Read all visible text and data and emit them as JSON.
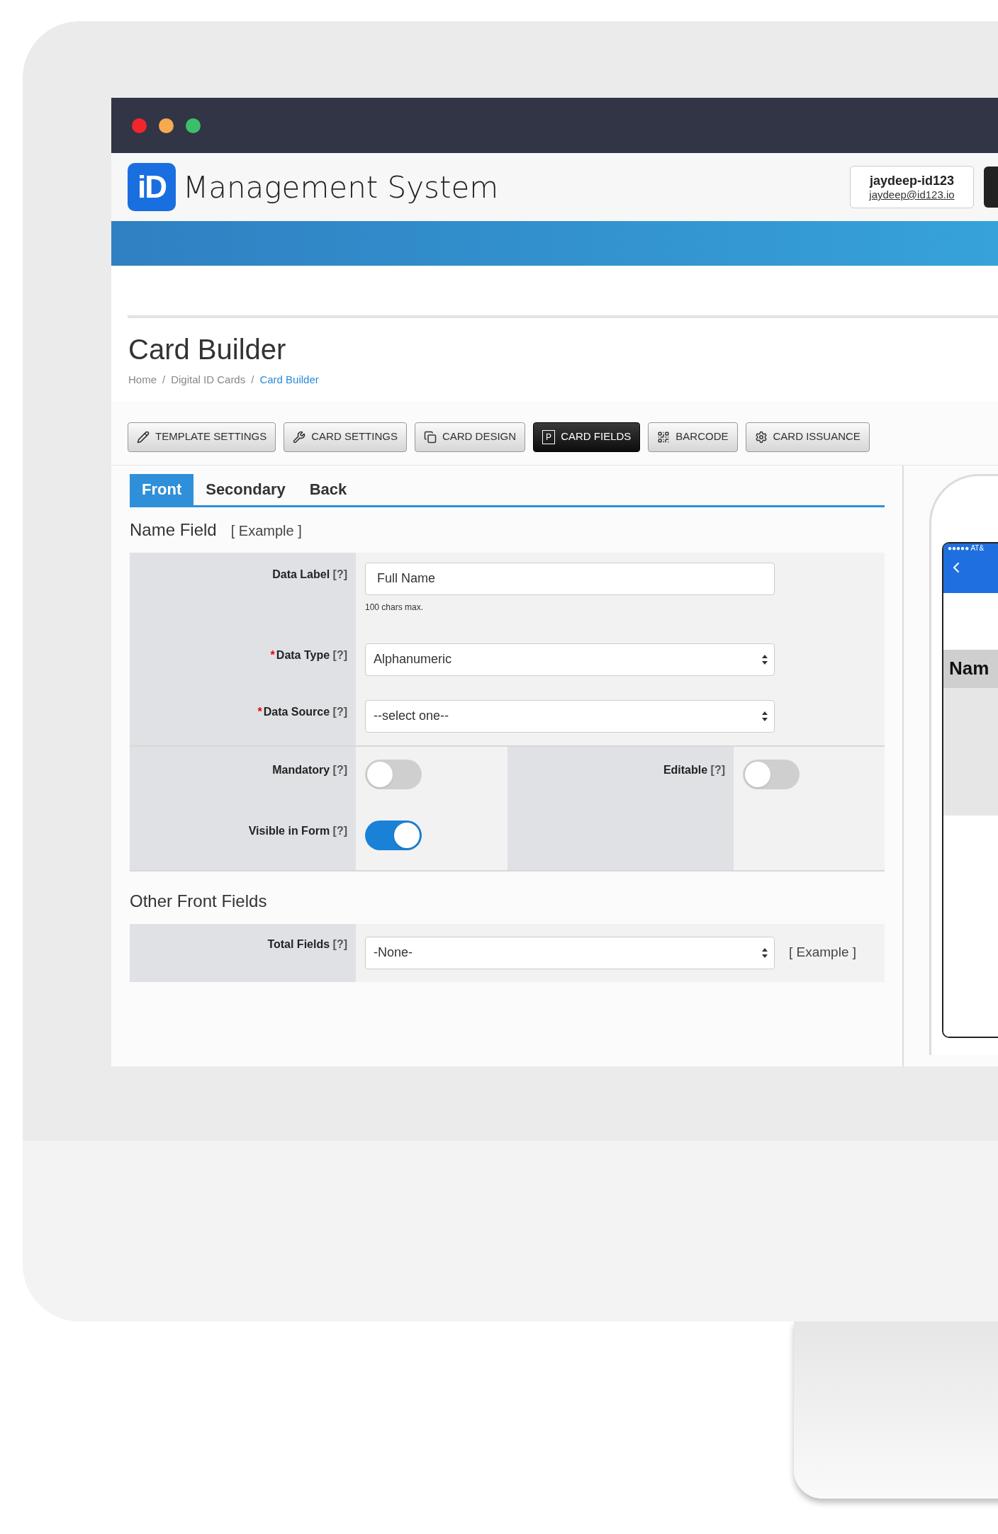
{
  "header": {
    "logo_text": "iD",
    "app_title": "Management System",
    "user": {
      "name": "jaydeep-id123",
      "email": "jaydeep@id123.io"
    }
  },
  "page": {
    "title": "Card Builder",
    "breadcrumb_separator": "/",
    "breadcrumb": [
      {
        "label": "Home",
        "current": false
      },
      {
        "label": "Digital ID Cards",
        "current": false
      },
      {
        "label": "Card Builder",
        "current": true
      }
    ]
  },
  "toolbar": [
    {
      "label": "TEMPLATE SETTINGS",
      "selected": false
    },
    {
      "label": "CARD SETTINGS",
      "selected": false
    },
    {
      "label": "CARD DESIGN",
      "selected": false
    },
    {
      "label": "CARD FIELDS",
      "selected": true,
      "icon_letter": "P"
    },
    {
      "label": "BARCODE",
      "selected": false
    },
    {
      "label": "CARD ISSUANCE",
      "selected": false
    }
  ],
  "tabs": [
    {
      "label": "Front",
      "selected": true
    },
    {
      "label": "Secondary",
      "selected": false
    },
    {
      "label": "Back",
      "selected": false
    }
  ],
  "name_field": {
    "title": "Name Field",
    "example": "[ Example ]",
    "fields": [
      {
        "kind": "text",
        "label": "Data Label",
        "help": "[?]",
        "value": "Full Name",
        "note": "100 chars max."
      },
      {
        "kind": "select",
        "required_mark": "*",
        "label": "Data Type",
        "help": "[?]",
        "value": "Alphanumeric"
      },
      {
        "kind": "select",
        "required_mark": "*",
        "label": "Data Source",
        "help": "[?]",
        "value": "--select one--"
      }
    ],
    "toggles_left": [
      {
        "label": "Mandatory",
        "help": "[?]",
        "on": false
      },
      {
        "label": "Visible in Form",
        "help": "[?]",
        "on": true
      }
    ],
    "toggles_right": [
      {
        "label": "Editable",
        "help": "[?]",
        "on": false
      }
    ]
  },
  "other_fields": {
    "title": "Other Front Fields",
    "label": "Total Fields",
    "help": "[?]",
    "value": "-None-",
    "example": "[ Example ]"
  },
  "phone_preview": {
    "status": "●●●●● AT&",
    "field_label": "Nam"
  }
}
